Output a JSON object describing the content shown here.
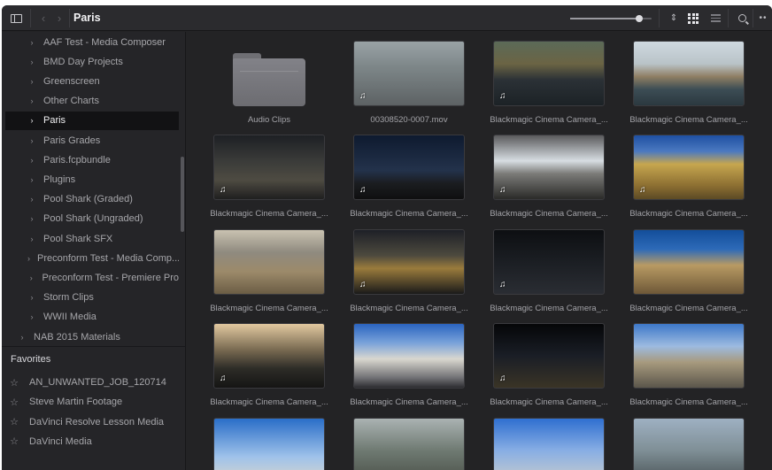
{
  "toolbar": {
    "title": "Paris",
    "back_glyph": "‹",
    "forward_glyph": "›",
    "zoom_slider_fraction": 0.85,
    "icons": [
      "sidebar-toggle-icon",
      "chevron-left-icon",
      "chevron-right-icon",
      "sort-icon",
      "grid-view-icon",
      "list-view-icon",
      "search-icon",
      "more-icon"
    ]
  },
  "sidebar": {
    "items": [
      {
        "label": "AAF Test - Media Composer",
        "selected": false
      },
      {
        "label": "BMD Day Projects",
        "selected": false
      },
      {
        "label": "Greenscreen",
        "selected": false
      },
      {
        "label": "Other Charts",
        "selected": false
      },
      {
        "label": "Paris",
        "selected": true
      },
      {
        "label": "Paris Grades",
        "selected": false
      },
      {
        "label": "Paris.fcpbundle",
        "selected": false
      },
      {
        "label": "Plugins",
        "selected": false
      },
      {
        "label": "Pool Shark (Graded)",
        "selected": false
      },
      {
        "label": "Pool Shark (Ungraded)",
        "selected": false
      },
      {
        "label": "Pool Shark SFX",
        "selected": false
      },
      {
        "label": "Preconform Test - Media Comp...",
        "selected": false
      },
      {
        "label": "Preconform Test - Premiere Pro",
        "selected": false
      },
      {
        "label": "Storm Clips",
        "selected": false
      },
      {
        "label": "WWII Media",
        "selected": false
      },
      {
        "label": "NAB 2015 Materials",
        "selected": false,
        "parent_level": true
      }
    ],
    "favorites_heading": "Favorites",
    "favorites": [
      "AN_UNWANTED_JOB_120714",
      "Steve Martin Footage",
      "DaVinci Resolve Lesson Media",
      "DaVinci Media"
    ]
  },
  "clips": [
    {
      "name": "Audio Clips",
      "kind": "folder",
      "audio": false
    },
    {
      "name": "00308520-0007.mov",
      "kind": "clip",
      "audio": true
    },
    {
      "name": "Blackmagic Cinema Camera_...",
      "kind": "clip",
      "audio": true
    },
    {
      "name": "Blackmagic Cinema Camera_...",
      "kind": "clip",
      "audio": false
    },
    {
      "name": "Blackmagic Cinema Camera_...",
      "kind": "clip",
      "audio": true
    },
    {
      "name": "Blackmagic Cinema Camera_...",
      "kind": "clip",
      "audio": true
    },
    {
      "name": "Blackmagic Cinema Camera_...",
      "kind": "clip",
      "audio": true
    },
    {
      "name": "Blackmagic Cinema Camera_...",
      "kind": "clip",
      "audio": true
    },
    {
      "name": "Blackmagic Cinema Camera_...",
      "kind": "clip",
      "audio": false
    },
    {
      "name": "Blackmagic Cinema Camera_...",
      "kind": "clip",
      "audio": true
    },
    {
      "name": "Blackmagic Cinema Camera_...",
      "kind": "clip",
      "audio": true
    },
    {
      "name": "Blackmagic Cinema Camera_...",
      "kind": "clip",
      "audio": false
    },
    {
      "name": "Blackmagic Cinema Camera_...",
      "kind": "clip",
      "audio": true
    },
    {
      "name": "Blackmagic Cinema Camera_...",
      "kind": "clip",
      "audio": false
    },
    {
      "name": "Blackmagic Cinema Camera_...",
      "kind": "clip",
      "audio": true
    },
    {
      "name": "Blackmagic Cinema Camera_...",
      "kind": "clip",
      "audio": false
    },
    {
      "name": "",
      "kind": "clip",
      "audio": false
    },
    {
      "name": "",
      "kind": "clip",
      "audio": false
    },
    {
      "name": "",
      "kind": "clip",
      "audio": false
    },
    {
      "name": "",
      "kind": "clip",
      "audio": false
    }
  ],
  "audio_glyph": "♫",
  "colors": {
    "window_bg": "#232325",
    "sidebar_bg": "#252528",
    "selection_bg": "#121214",
    "text": "#a6a6aa"
  }
}
